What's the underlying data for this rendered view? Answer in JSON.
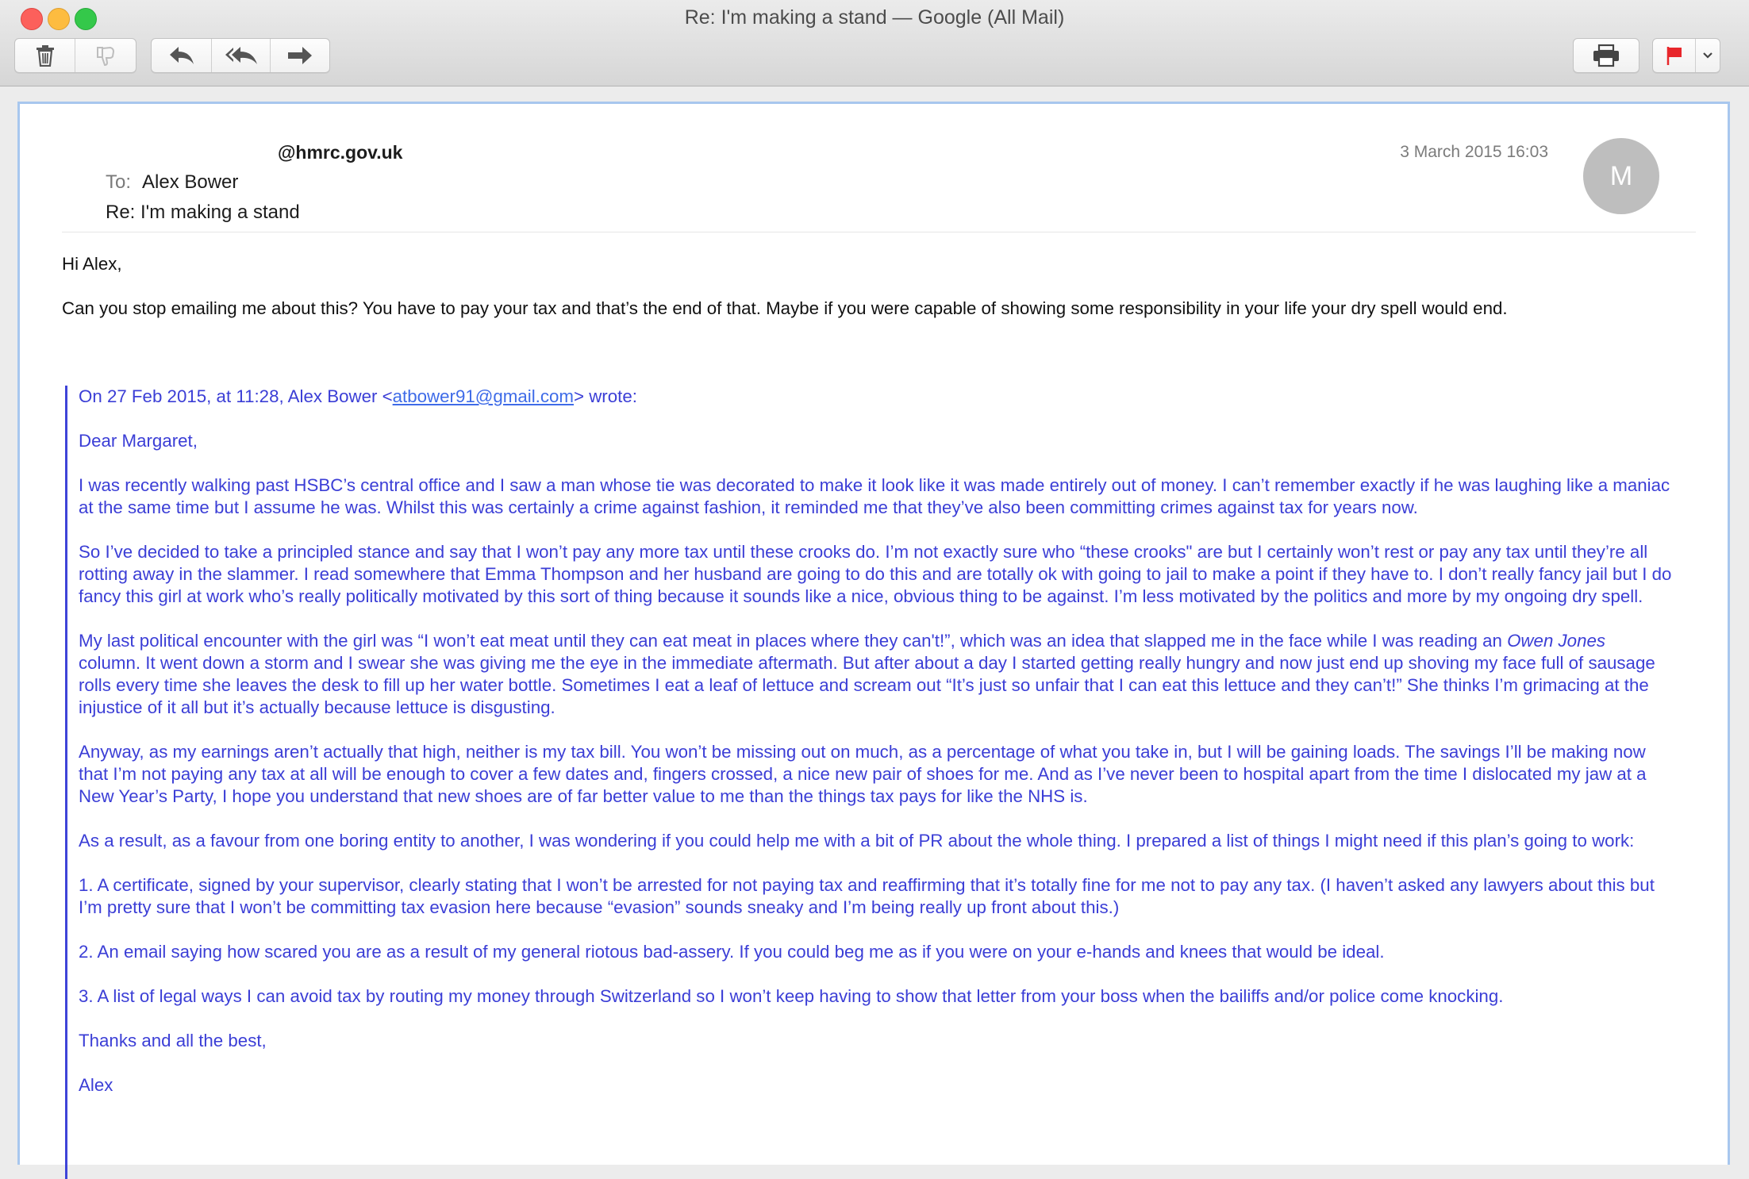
{
  "window": {
    "title": "Re: I'm making a stand — Google (All Mail)"
  },
  "toolbar": {
    "delete": "trash-icon",
    "junk": "thumbs-down-icon",
    "reply": "reply-icon",
    "reply_all": "reply-all-icon",
    "forward": "forward-icon",
    "print": "printer-icon",
    "flag": "flag-icon",
    "flag_menu": "chevron-down-icon"
  },
  "colors": {
    "flag": "#e8262b",
    "quote_text": "#3b3ed6",
    "quote_bar": "#3e44d8",
    "link": "#3e6be8",
    "frame_border": "#a8c7ee"
  },
  "message": {
    "from": "@hmrc.gov.uk",
    "to_label": "To:",
    "to": "Alex Bower",
    "subject": "Re: I'm making a stand",
    "date": "3 March 2015 16:03",
    "avatar_initial": "M",
    "greeting": "Hi Alex,",
    "body": "Can you stop emailing me about this? You have to pay your tax and that’s the end of that. Maybe if you were capable of showing some responsibility in your life your dry spell would end."
  },
  "quoted": {
    "attribution_prefix": "On 27 Feb 2015, at 11:28, Alex Bower <",
    "attribution_email": "atbower91@gmail.com",
    "attribution_suffix": "> wrote:",
    "salutation": "Dear Margaret,",
    "p1": "I was recently walking past HSBC’s central office and I saw a man whose tie was decorated to make it look like it was made entirely out of money. I can’t remember exactly if he was laughing like a maniac at the same time but I assume he was. Whilst this was certainly a crime against fashion, it reminded me that they’ve also been committing crimes against tax for years now.",
    "p2": "So I’ve decided to take a principled stance and say that I won’t pay any more tax until these crooks do. I’m not exactly sure who “these crooks\" are but I certainly won’t rest or pay any tax until they’re all rotting away in the slammer. I read somewhere that Emma Thompson and her husband are going to do this and are totally ok with going to jail to make a point if they have to. I don’t really fancy jail but I do fancy this girl at work who’s really politically motivated by this sort of thing because it sounds like a nice, obvious thing to be against. I’m less motivated by the politics and more by my ongoing dry spell.",
    "p3_a": "My last political encounter with the girl was “I won’t eat meat until they can eat meat in places where they can't!”, which was an idea that slapped me in the face while I was reading an ",
    "p3_em": "Owen Jones",
    "p3_b": " column. It went down a storm and I swear she was giving me the eye in the immediate aftermath. But after about a day I started getting really hungry and now just end up shoving my face full of sausage rolls every time she leaves the desk to fill up her water bottle. Sometimes I eat a leaf of lettuce and scream out “It’s just so unfair that I can eat this lettuce and they can’t!” She thinks I’m grimacing at the injustice of it all but it’s actually because lettuce is disgusting.",
    "p4": "Anyway, as my earnings aren’t actually that high, neither is my tax bill. You won’t be missing out on much, as a percentage of what you take in, but I will be gaining loads. The savings I’ll be making now that I’m not paying any tax at all will be enough to cover a few dates and, fingers crossed, a nice new pair of shoes for me. And as I’ve never been to hospital apart from the time I dislocated my jaw at a New Year’s Party, I hope you understand that new shoes are of far better value to me than the things tax pays for like the NHS is.",
    "p5": "As a result, as a favour from one boring entity to another, I was wondering if you could help me with a bit of PR about the whole thing. I prepared a list of things I might need if this plan’s going to work:",
    "item1": "1. A certificate, signed by your supervisor, clearly stating that I won’t be arrested for not paying tax and reaffirming that it’s totally fine for me not to pay any tax. (I haven’t asked any lawyers about this but I’m pretty sure that I won’t be committing tax evasion here because “evasion” sounds sneaky and I’m being really up front about this.)",
    "item2": "2. An email saying how scared you are as a result of my general riotous bad-assery. If you could beg me as if you were on your e-hands and knees that would be ideal.",
    "item3": "3. A list of legal ways I can avoid tax by routing my money through Switzerland so I won’t keep having to show that letter from your boss when the bailiffs and/or police come knocking.",
    "signoff": "Thanks and all the best,",
    "signature": "Alex"
  }
}
